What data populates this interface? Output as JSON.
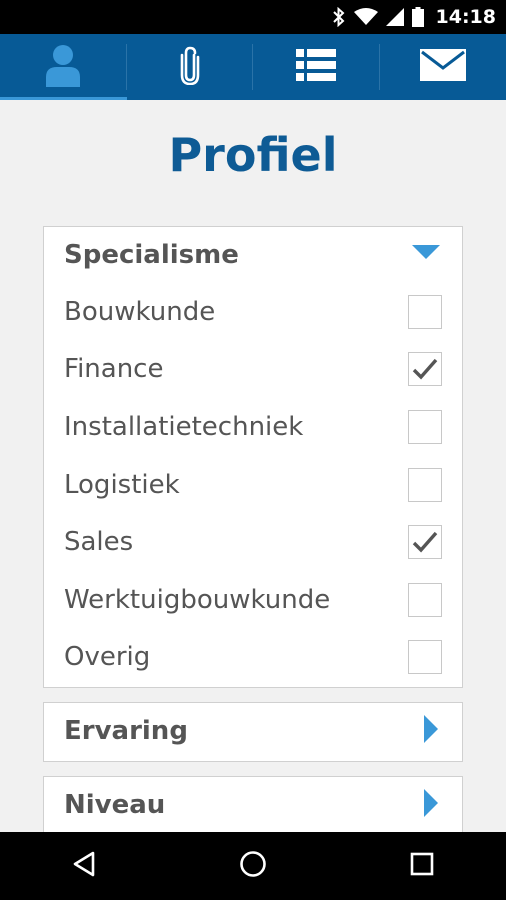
{
  "status_bar": {
    "time": "14:18",
    "icons": [
      "bluetooth-icon",
      "wifi-icon",
      "cell-signal-icon",
      "battery-icon"
    ]
  },
  "tabs": [
    {
      "icon": "person-icon",
      "active": true
    },
    {
      "icon": "paperclip-icon",
      "active": false
    },
    {
      "icon": "list-icon",
      "active": false
    },
    {
      "icon": "envelope-icon",
      "active": false
    }
  ],
  "page": {
    "title": "Profiel"
  },
  "sections": {
    "specialisme": {
      "title": "Specialisme",
      "expanded": true,
      "options": [
        {
          "label": "Bouwkunde",
          "checked": false
        },
        {
          "label": "Finance",
          "checked": true
        },
        {
          "label": "Installatietechniek",
          "checked": false
        },
        {
          "label": "Logistiek",
          "checked": false
        },
        {
          "label": "Sales",
          "checked": true
        },
        {
          "label": "Werktuigbouwkunde",
          "checked": false
        },
        {
          "label": "Overig",
          "checked": false
        }
      ]
    },
    "ervaring": {
      "title": "Ervaring",
      "expanded": false
    },
    "niveau": {
      "title": "Niveau",
      "expanded": false
    }
  },
  "nav_bar": {
    "buttons": [
      "back-icon",
      "home-icon",
      "recents-icon"
    ]
  },
  "colors": {
    "brand_blue": "#075a96",
    "title_blue": "#0e5b95",
    "accent_blue": "#3a98d8",
    "text_gray": "#555555",
    "background": "#f1f1f1"
  }
}
